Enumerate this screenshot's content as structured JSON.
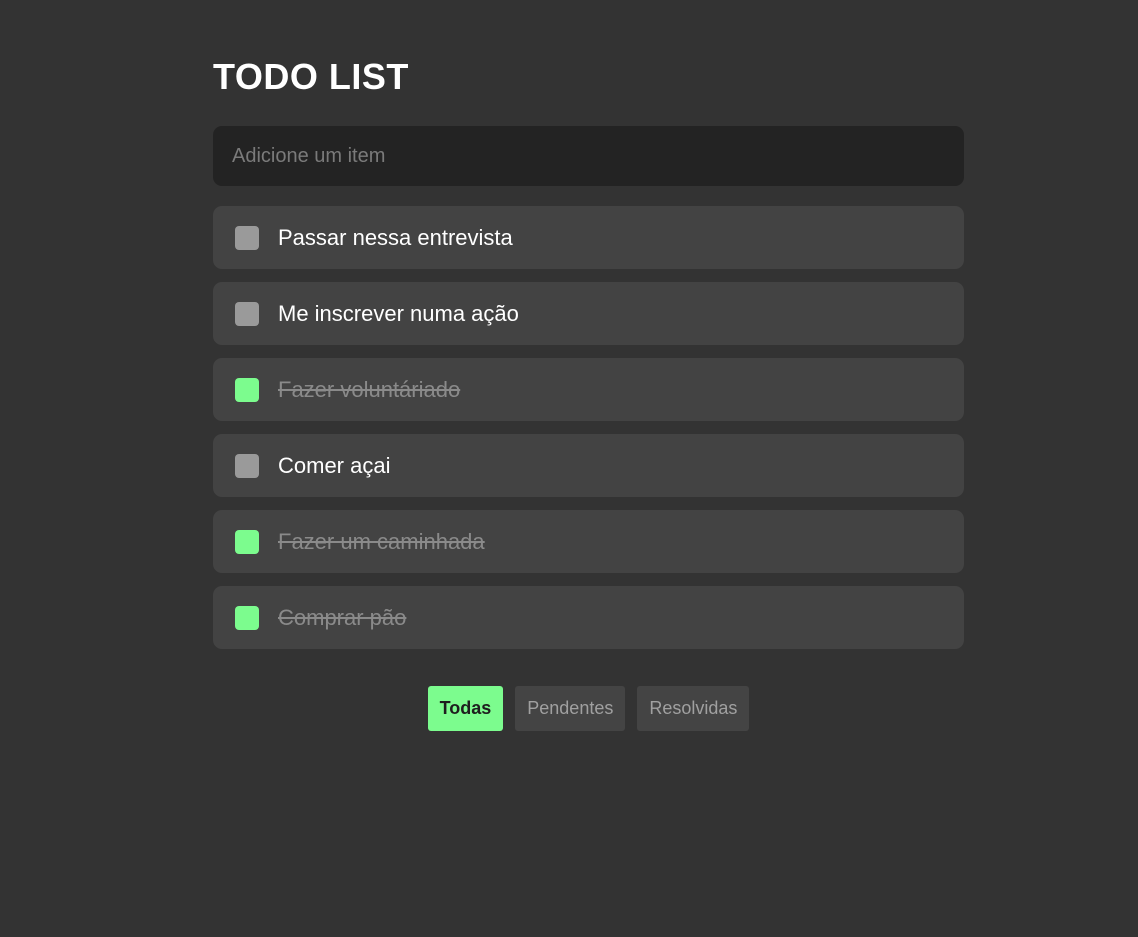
{
  "header": {
    "title": "TODO LIST"
  },
  "input": {
    "placeholder": "Adicione um item",
    "value": ""
  },
  "todos": [
    {
      "label": "Passar nessa entrevista",
      "done": false
    },
    {
      "label": "Me inscrever numa ação",
      "done": false
    },
    {
      "label": "Fazer voluntáriado",
      "done": true
    },
    {
      "label": "Comer açai",
      "done": false
    },
    {
      "label": "Fazer um caminhada",
      "done": true
    },
    {
      "label": "Comprar pão",
      "done": true
    }
  ],
  "filters": {
    "items": [
      {
        "label": "Todas",
        "active": true
      },
      {
        "label": "Pendentes",
        "active": false
      },
      {
        "label": "Resolvidas",
        "active": false
      }
    ]
  },
  "colors": {
    "background": "#333333",
    "accent": "#7cfc8e",
    "item_bg": "#434343",
    "input_bg": "#232323",
    "unchecked": "#9a9a9a"
  }
}
